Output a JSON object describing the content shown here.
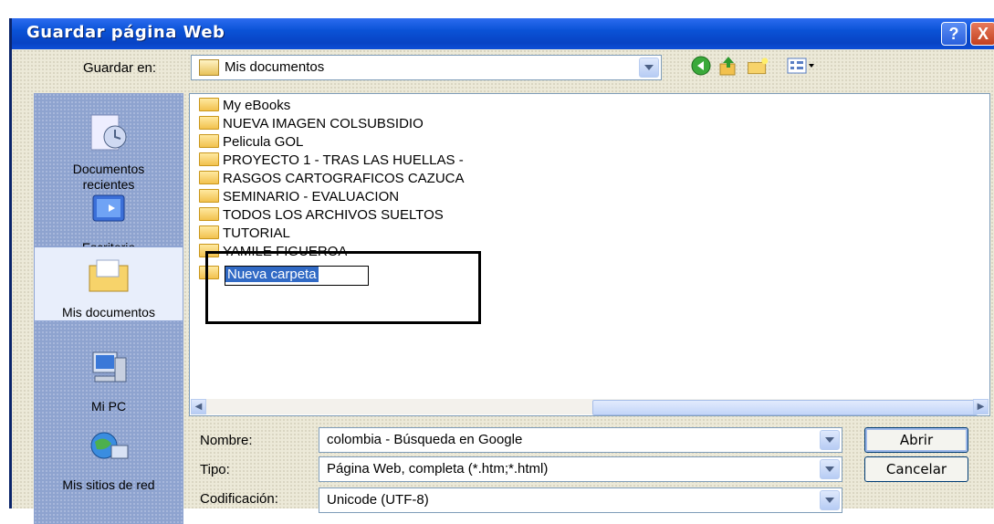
{
  "window": {
    "title": "Guardar página Web",
    "help_label": "?",
    "close_label": "X"
  },
  "toolbar": {
    "save_in_label": "Guardar en:",
    "save_in_value": "Mis documentos"
  },
  "places": [
    {
      "label": "Documentos recientes",
      "icon": "recent-docs-icon"
    },
    {
      "label": "Escritorio",
      "icon": "desktop-icon"
    },
    {
      "label": "Mis documentos",
      "icon": "my-documents-icon",
      "selected": true
    },
    {
      "label": "Mi PC",
      "icon": "my-computer-icon"
    },
    {
      "label": "Mis sitios de red",
      "icon": "network-places-icon"
    }
  ],
  "files": [
    "My eBooks",
    "NUEVA IMAGEN COLSUBSIDIO",
    "Pelicula GOL",
    "PROYECTO 1 - TRAS LAS HUELLAS -",
    "RASGOS CARTOGRAFICOS CAZUCA",
    "SEMINARIO - EVALUACION",
    "TODOS LOS ARCHIVOS SUELTOS",
    "TUTORIAL",
    "YAMILE FIGUEROA"
  ],
  "new_folder_value": "Nueva carpeta",
  "form": {
    "name_label": "Nombre:",
    "name_value": "colombia - Búsqueda en Google",
    "type_label": "Tipo:",
    "type_value": "Página Web, completa (*.htm;*.html)",
    "encoding_label": "Codificación:",
    "encoding_value": "Unicode (UTF-8)"
  },
  "buttons": {
    "open": "Abrir",
    "cancel": "Cancelar"
  }
}
